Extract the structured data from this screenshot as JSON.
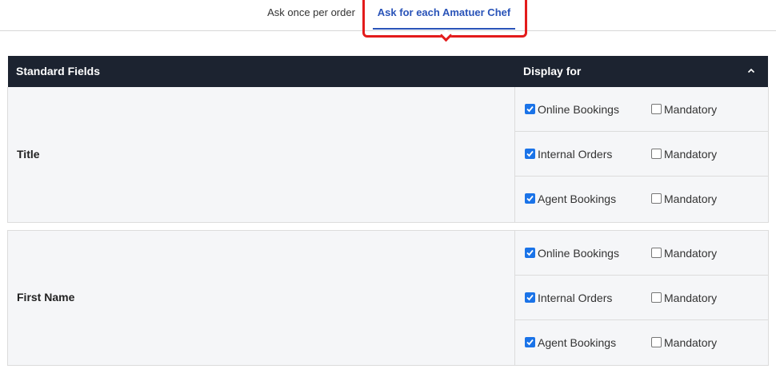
{
  "tabs": {
    "ask_once": "Ask once per order",
    "ask_each": "Ask for each Amatuer Chef"
  },
  "table": {
    "col_fields": "Standard Fields",
    "col_display": "Display for"
  },
  "fields": [
    {
      "name": "Title",
      "options": [
        {
          "label": "Online Bookings",
          "checked": true,
          "mandatory_label": "Mandatory",
          "mandatory": false
        },
        {
          "label": "Internal Orders",
          "checked": true,
          "mandatory_label": "Mandatory",
          "mandatory": false
        },
        {
          "label": "Agent Bookings",
          "checked": true,
          "mandatory_label": "Mandatory",
          "mandatory": false
        }
      ]
    },
    {
      "name": "First Name",
      "options": [
        {
          "label": "Online Bookings",
          "checked": true,
          "mandatory_label": "Mandatory",
          "mandatory": false
        },
        {
          "label": "Internal Orders",
          "checked": true,
          "mandatory_label": "Mandatory",
          "mandatory": false
        },
        {
          "label": "Agent Bookings",
          "checked": true,
          "mandatory_label": "Mandatory",
          "mandatory": false
        }
      ]
    }
  ],
  "colors": {
    "accent": "#2953b8",
    "header_bg": "#1c2330",
    "highlight": "#e31b1b",
    "checkbox": "#1a73e8"
  }
}
